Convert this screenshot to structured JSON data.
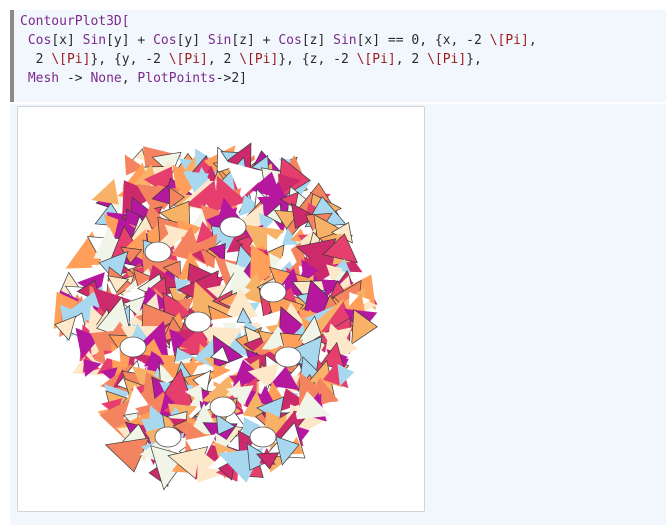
{
  "code_cell": {
    "lines": [
      {
        "tokens": [
          {
            "t": "ContourPlot3D[",
            "c": "fn"
          }
        ]
      },
      {
        "tokens": [
          {
            "t": " "
          },
          {
            "t": "Cos",
            "c": "fn"
          },
          {
            "t": "[x] "
          },
          {
            "t": "Sin",
            "c": "fn"
          },
          {
            "t": "[y] + "
          },
          {
            "t": "Cos",
            "c": "fn"
          },
          {
            "t": "[y] "
          },
          {
            "t": "Sin",
            "c": "fn"
          },
          {
            "t": "[z] + "
          },
          {
            "t": "Cos",
            "c": "fn"
          },
          {
            "t": "[z] "
          },
          {
            "t": "Sin",
            "c": "fn"
          },
          {
            "t": "[x] == 0, {x, -2 "
          },
          {
            "t": "\\[Pi]",
            "c": "str"
          },
          {
            "t": ","
          }
        ]
      },
      {
        "tokens": [
          {
            "t": "  2 "
          },
          {
            "t": "\\[Pi]",
            "c": "str"
          },
          {
            "t": "}, {y, -2 "
          },
          {
            "t": "\\[Pi]",
            "c": "str"
          },
          {
            "t": ", 2 "
          },
          {
            "t": "\\[Pi]",
            "c": "str"
          },
          {
            "t": "}, {z, -2 "
          },
          {
            "t": "\\[Pi]",
            "c": "str"
          },
          {
            "t": ", 2 "
          },
          {
            "t": "\\[Pi]",
            "c": "str"
          },
          {
            "t": "},"
          }
        ]
      },
      {
        "tokens": [
          {
            "t": " "
          },
          {
            "t": "Mesh",
            "c": "fn"
          },
          {
            "t": " -> "
          },
          {
            "t": "None",
            "c": "fn"
          },
          {
            "t": ", "
          },
          {
            "t": "PlotPoints",
            "c": "fn"
          },
          {
            "t": "->2]"
          }
        ]
      }
    ]
  },
  "output_cell": {
    "graphic": "gyroid-surface-3d",
    "colors": [
      "#f7b267",
      "#f4845f",
      "#e63e6d",
      "#b5179e",
      "#a8d8f0",
      "#fde9c9",
      "#f0f5e8",
      "#ffffff",
      "#cc2a6b",
      "#ff9f5a"
    ]
  }
}
